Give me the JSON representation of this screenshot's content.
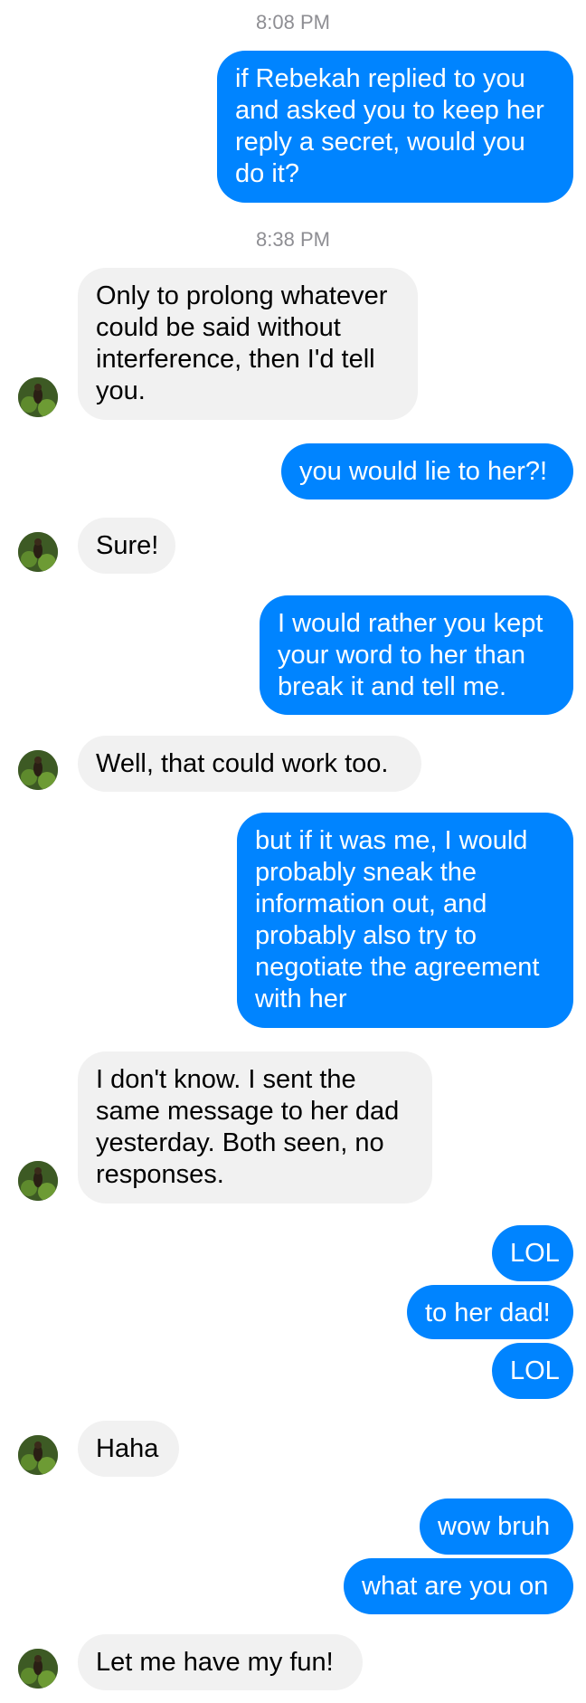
{
  "conversation": {
    "timestamps": [
      "8:08 PM",
      "8:38 PM"
    ],
    "messages": [
      {
        "from": "me",
        "text": "if Rebekah replied to you and asked you to keep her reply a secret, would you do it?"
      },
      {
        "from": "them",
        "text": "Only to prolong whatever could be said without interference, then I'd tell you."
      },
      {
        "from": "me",
        "text": "you would lie to her?!"
      },
      {
        "from": "them",
        "text": "Sure!"
      },
      {
        "from": "me",
        "text": "I would rather you kept your word to her than break it and tell me."
      },
      {
        "from": "them",
        "text": "Well, that could work too."
      },
      {
        "from": "me",
        "text": "but if it was me, I would probably sneak the information out, and probably also try to negotiate the agreement with her"
      },
      {
        "from": "them",
        "text": "I don't know. I sent the same message to her dad yesterday. Both seen, no responses."
      },
      {
        "from": "me",
        "text": "LOL"
      },
      {
        "from": "me",
        "text": "to her dad!"
      },
      {
        "from": "me",
        "text": "LOL"
      },
      {
        "from": "them",
        "text": "Haha"
      },
      {
        "from": "me",
        "text": "wow bruh"
      },
      {
        "from": "me",
        "text": "what are you on"
      },
      {
        "from": "them",
        "text": "Let me have my fun!"
      }
    ]
  },
  "icons": {
    "avatar": "contact-avatar-photo"
  },
  "colors": {
    "outgoing": "#0084ff",
    "incoming": "#f1f1f1",
    "timestamp": "#8e8e93",
    "background": "#ffffff"
  }
}
